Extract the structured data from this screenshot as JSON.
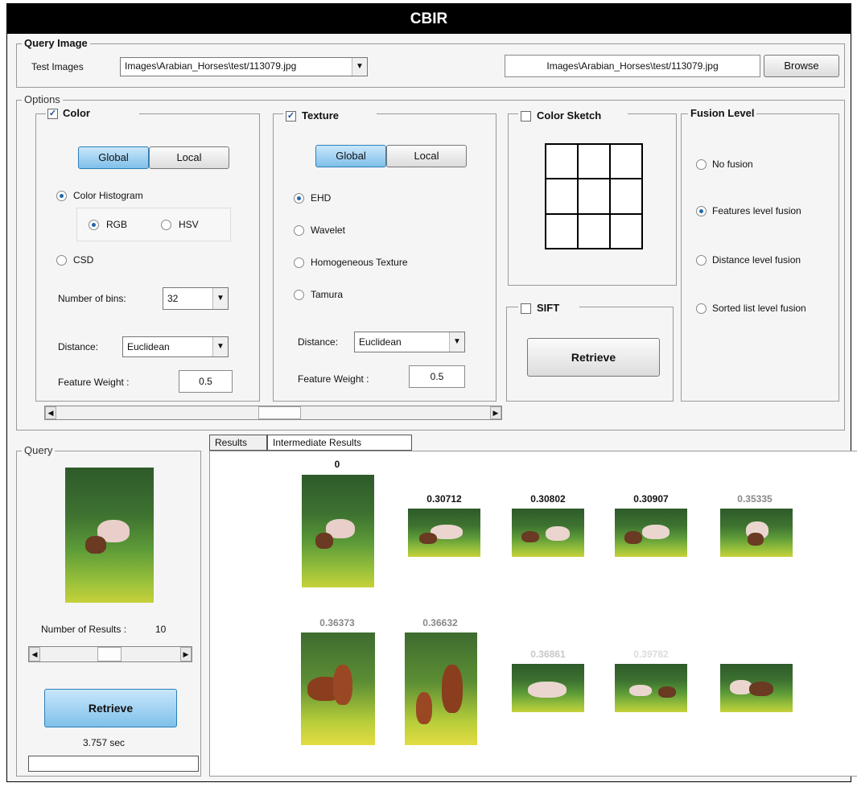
{
  "window": {
    "title": "CBIR"
  },
  "query_image": {
    "group_label": "Query Image",
    "test_images_label": "Test Images",
    "selected_path": "Images\\Arabian_Horses\\test/113079.jpg",
    "path_field": "Images\\Arabian_Horses\\test/113079.jpg",
    "browse_label": "Browse"
  },
  "options": {
    "group_label": "Options",
    "color": {
      "label": "Color",
      "checked": true,
      "global_label": "Global",
      "local_label": "Local",
      "color_histogram_label": "Color Histogram",
      "rgb_label": "RGB",
      "hsv_label": "HSV",
      "csd_label": "CSD",
      "bins_label": "Number of bins:",
      "bins_value": "32",
      "distance_label": "Distance:",
      "distance_value": "Euclidean",
      "weight_label": "Feature Weight :",
      "weight_value": "0.5"
    },
    "texture": {
      "label": "Texture",
      "checked": true,
      "global_label": "Global",
      "local_label": "Local",
      "ehd_label": "EHD",
      "wavelet_label": "Wavelet",
      "homogeneous_label": "Homogeneous Texture",
      "tamura_label": "Tamura",
      "distance_label": "Distance:",
      "distance_value": "Euclidean",
      "weight_label": "Feature Weight :",
      "weight_value": "0.5"
    },
    "color_sketch": {
      "label": "Color Sketch",
      "checked": false
    },
    "sift": {
      "label": "SIFT",
      "checked": false,
      "retrieve_label": "Retrieve"
    },
    "fusion": {
      "label": "Fusion Level",
      "options": [
        "No fusion",
        "Features level fusion",
        "Distance level fusion",
        "Sorted list level fusion"
      ],
      "selected": "Features level fusion"
    }
  },
  "query": {
    "group_label": "Query",
    "num_results_label": "Number of Results :",
    "num_results_value": "10",
    "retrieve_label": "Retrieve",
    "time_text": "3.757 sec"
  },
  "results": {
    "tabs": [
      "Results",
      "Intermediate Results"
    ],
    "scores": [
      "0",
      "0.30712",
      "0.30802",
      "0.30907",
      "0.35335",
      "0.36373",
      "0.36632",
      "0.36861",
      "0.39782"
    ]
  },
  "colors": {
    "title_bg": "#000000",
    "accent": "#7fc0ea",
    "panel_bg": "#f5f5f5"
  }
}
